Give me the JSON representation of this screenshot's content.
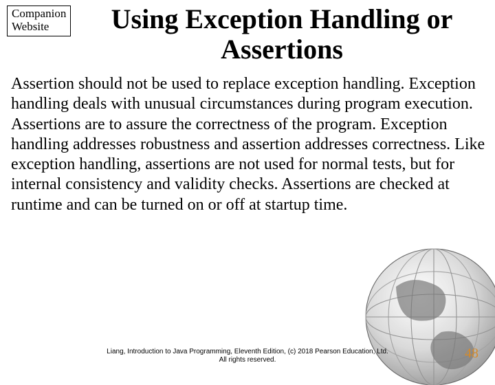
{
  "badge": {
    "line1": "Companion",
    "line2": "Website"
  },
  "title": "Using Exception Handling or Assertions",
  "body": "Assertion should not be used to replace exception handling. Exception handling deals with unusual circumstances during program execution. Assertions are to assure the correctness of the program. Exception handling addresses robustness and assertion addresses correctness. Like exception handling, assertions are not used for normal tests, but for internal consistency and validity checks. Assertions are checked at runtime and can be turned on or off at startup time.",
  "footer": {
    "line1": "Liang, Introduction to Java Programming, Eleventh Edition, (c) 2018 Pearson Education, Ltd.",
    "line2": "All rights reserved."
  },
  "page_number": "48"
}
